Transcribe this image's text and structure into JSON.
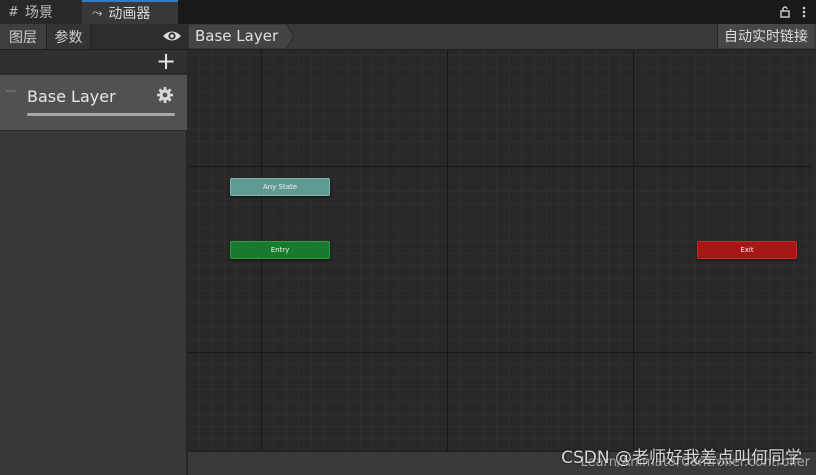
{
  "tabs": [
    {
      "label": "场景",
      "icon": "grid-icon"
    },
    {
      "label": "动画器",
      "icon": "animator-icon"
    }
  ],
  "window_icons": [
    "lock-icon",
    "kebab-menu-icon"
  ],
  "left_panel": {
    "tabs": [
      {
        "label": "图层"
      },
      {
        "label": "参数"
      }
    ],
    "layer": {
      "name": "Base Layer"
    }
  },
  "graph": {
    "breadcrumb": "Base Layer",
    "live_link_button": "自动实时链接",
    "nodes": [
      {
        "label": "Any State",
        "color": "#5e9c93"
      },
      {
        "label": "Entry",
        "color": "#187a2c"
      },
      {
        "label": "Exit",
        "color": "#a81717"
      }
    ],
    "status_path": "Learn/AnimatorController.controller"
  },
  "watermark": "CSDN @老师好我差点叫何同学"
}
